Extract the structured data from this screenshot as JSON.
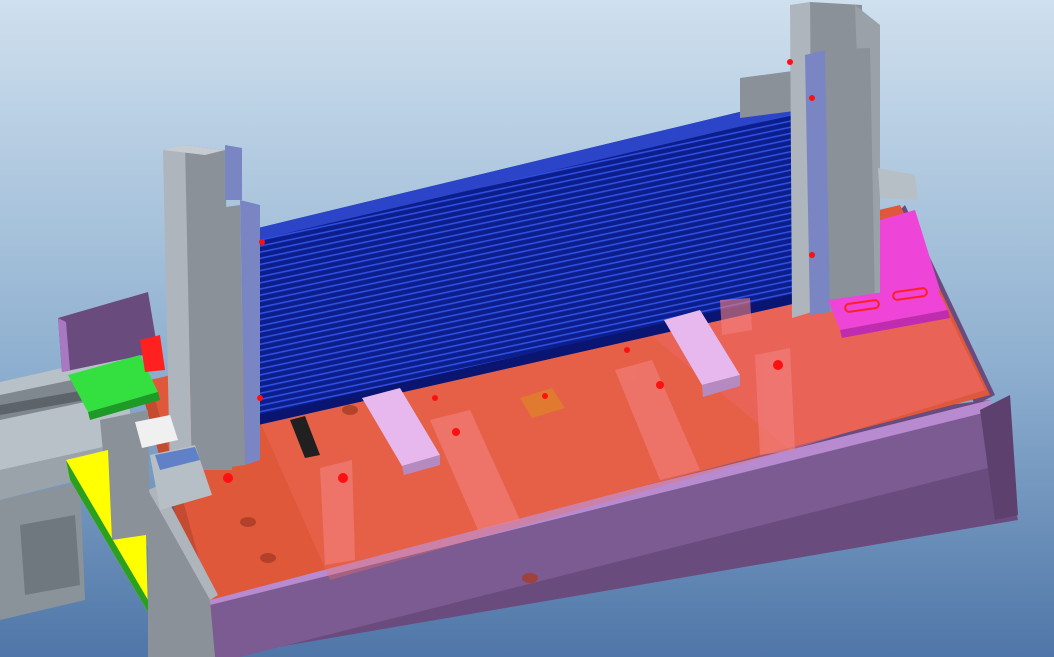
{
  "scene": {
    "description_visible_text": [],
    "colors": {
      "background_top": "#c8dbea",
      "background_bottom": "#4f76a8",
      "tray": "#6a4b7e",
      "tray_light": "#a878c0",
      "base_plate": "#e0583a",
      "red_overlay": "#f06a6a",
      "heat_exchanger": "#0c1e8c",
      "heat_exchanger_fin": "#2a48d8",
      "pillar": "#8a9198",
      "pillar_light": "#aeb5bc",
      "cap": "#7a86c4",
      "support_block": "#e6b8ee",
      "pink_clamp": "#ee44d8",
      "green_block": "#33e040",
      "yellow_panel": "#ffff00",
      "rail": "#b7bfc6",
      "orange_block": "#e07a30",
      "bolt": "#ff1010"
    }
  }
}
